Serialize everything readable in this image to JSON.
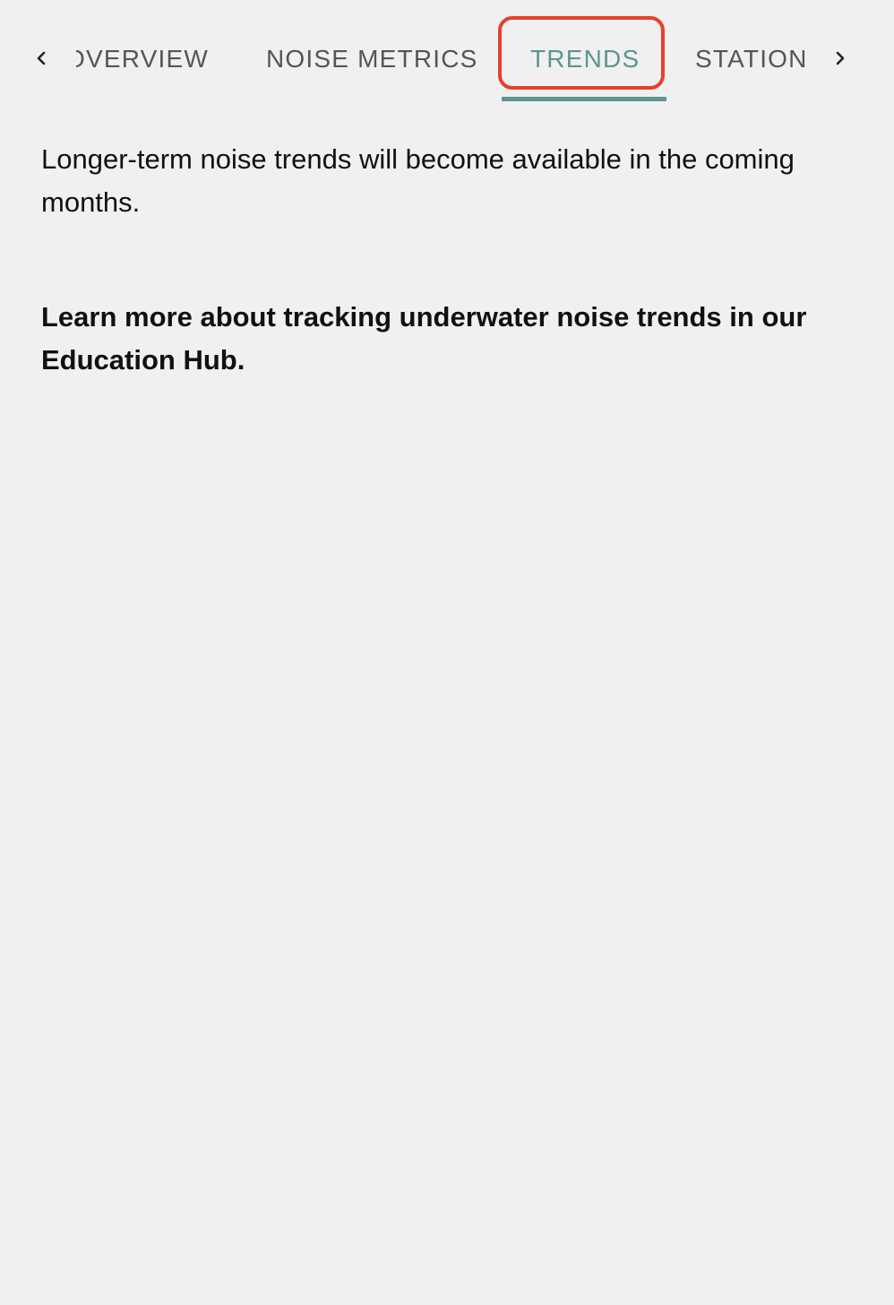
{
  "tabs": [
    {
      "label": "OVERVIEW",
      "active": false
    },
    {
      "label": "NOISE METRICS",
      "active": false
    },
    {
      "label": "TRENDS",
      "active": true
    },
    {
      "label": "STATION",
      "active": false
    }
  ],
  "icons": {
    "left": "chevron-left-icon",
    "right": "chevron-right-icon"
  },
  "colors": {
    "active_tab": "#5d9690",
    "highlight_border": "#e5402b",
    "background": "#f0f0f0"
  },
  "content": {
    "intro_text": "Longer-term noise trends will become available in the coming months.",
    "link_text": "Learn more about tracking underwater noise trends in our Education Hub."
  }
}
